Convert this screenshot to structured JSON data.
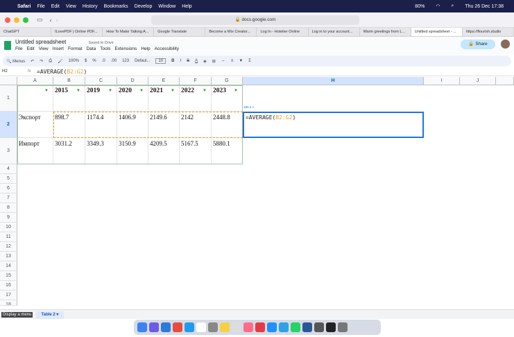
{
  "macos": {
    "menu": [
      "Safari",
      "File",
      "Edit",
      "View",
      "History",
      "Bookmarks",
      "Develop",
      "Window",
      "Help"
    ],
    "battery": "80%",
    "clock": "Thu 26 Dec 17:38"
  },
  "browser": {
    "url": "docs.google.com",
    "tabs": [
      "ChatGPT",
      "ILovePDF | Online PDF...",
      "How To Make Talking A...",
      "Google Translate",
      "Become a Wix Creator...",
      "Log In - Hotelier Online",
      "Log in to your account...",
      "Warm greetings from L...",
      "Untitled spreadsheet - ...",
      "https://flourish.studio"
    ]
  },
  "doc": {
    "title": "Untitled spreadsheet",
    "saved": "Saved to Drive",
    "menu": [
      "File",
      "Edit",
      "View",
      "Insert",
      "Format",
      "Data",
      "Tools",
      "Extensions",
      "Help",
      "Accessibility"
    ],
    "share": "Share"
  },
  "toolbar": {
    "menus": "Menus",
    "zoom": "100%",
    "currency": "$",
    "percent": "%",
    "decimals": ".0",
    "dec_more": ".00",
    "num_fmt": "123",
    "font": "Defaul...",
    "font_size": "10"
  },
  "formula_bar": {
    "cell_ref": "H2",
    "fx": "fx",
    "formula_prefix": "=AVERAGE(",
    "formula_range": "B2:G2",
    "formula_suffix": ")"
  },
  "grid": {
    "columns": [
      "A",
      "B",
      "C",
      "D",
      "E",
      "F",
      "G",
      "H",
      "I",
      "J"
    ],
    "rows": [
      "1",
      "2",
      "3",
      "4",
      "5",
      "6",
      "7",
      "8",
      "9",
      "10",
      "11",
      "12",
      "13",
      "14",
      "15",
      "16",
      "17",
      "18"
    ],
    "header_row": [
      "",
      "2015",
      "2019",
      "2020",
      "2021",
      "2022",
      "2023"
    ],
    "data_rows": [
      [
        "Экспорт",
        "898.7",
        "1174.4",
        "1406.9",
        "2149.6",
        "2142",
        "2448.8"
      ],
      [
        "Импорт",
        "3031.2",
        "3349.3",
        "3150.9",
        "4209.5",
        "5167.5",
        "5880.1"
      ]
    ],
    "active_cell_text_prefix": "=AVERAGE(",
    "active_cell_range": "B2:G2",
    "active_cell_suffix": ")",
    "tooltip": "180.4 ×"
  },
  "sheets": {
    "tab": "Table 2",
    "tooltip": "Display a menu"
  }
}
